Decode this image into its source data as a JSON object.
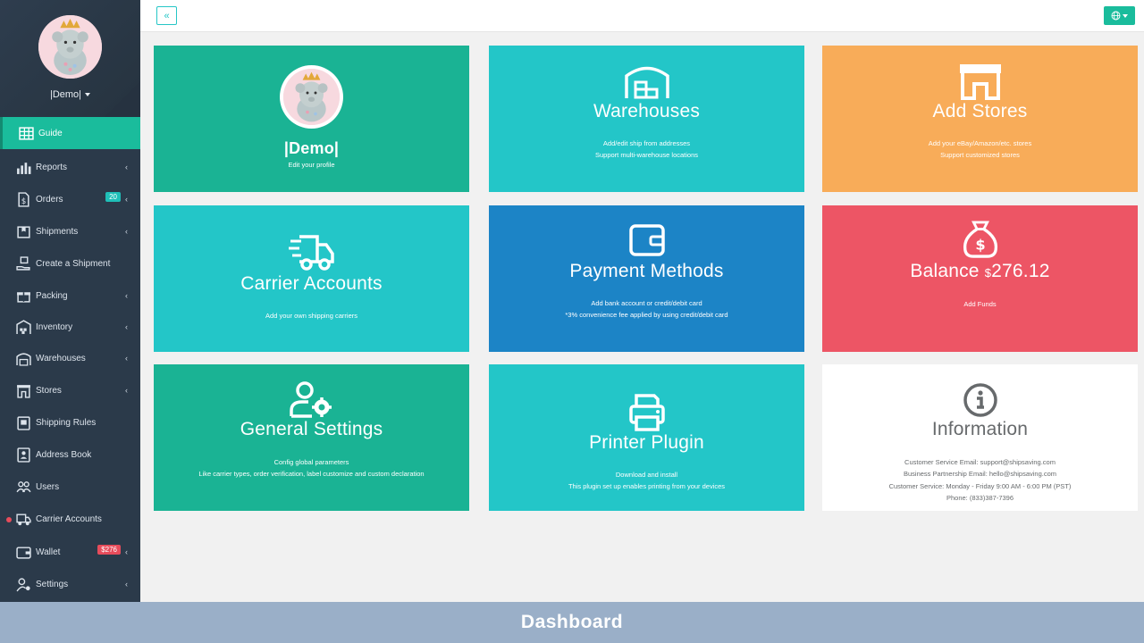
{
  "sidebar": {
    "profile_name": "|Demo|",
    "items": [
      {
        "label": "Guide",
        "icon": "grid-icon"
      },
      {
        "label": "Reports",
        "icon": "bar-chart-icon"
      },
      {
        "label": "Orders",
        "icon": "document-icon",
        "badge": "20"
      },
      {
        "label": "Shipments",
        "icon": "box-icon"
      },
      {
        "label": "Create a Shipment",
        "icon": "hand-box-icon"
      },
      {
        "label": "Packing",
        "icon": "gift-icon"
      },
      {
        "label": "Inventory",
        "icon": "warehouse-icon"
      },
      {
        "label": "Warehouses",
        "icon": "warehouse-icon"
      },
      {
        "label": "Stores",
        "icon": "store-icon"
      },
      {
        "label": "Shipping Rules",
        "icon": "clipboard-icon"
      },
      {
        "label": "Address Book",
        "icon": "address-book-icon"
      },
      {
        "label": "Users",
        "icon": "users-icon"
      },
      {
        "label": "Carrier Accounts",
        "icon": "truck-icon"
      },
      {
        "label": "Wallet",
        "icon": "wallet-icon",
        "badge": "$276"
      },
      {
        "label": "Settings",
        "icon": "user-gear-icon"
      }
    ]
  },
  "topbar": {
    "collapse_label": "«",
    "lang_icon": "globe-icon"
  },
  "cards": {
    "profile": {
      "name": "|Demo|",
      "sub": "Edit your profile"
    },
    "warehouses": {
      "title": "Warehouses",
      "line1": "Add/edit ship from addresses",
      "line2": "Support multi-warehouse locations"
    },
    "stores": {
      "title": "Add Stores",
      "line1": "Add your eBay/Amazon/etc. stores",
      "line2": "Support customized stores"
    },
    "carriers": {
      "title": "Carrier Accounts",
      "line1": "Add your own shipping carriers"
    },
    "payment": {
      "title": "Payment Methods",
      "line1": "Add bank account or credit/debit card",
      "line2": "*3% convenience fee applied by using credit/debit card"
    },
    "balance": {
      "title": "Balance",
      "currency": "$",
      "amount": "276.12",
      "line1": "Add Funds"
    },
    "settings": {
      "title": "General Settings",
      "line1": "Config global parameters",
      "line2": "Like carrier types, order verification, label customize and custom declaration"
    },
    "printer": {
      "title": "Printer Plugin",
      "line1": "Download and install",
      "line2": "This plugin set up enables printing from your devices"
    },
    "information": {
      "title": "Information",
      "line1": "Customer Service Email: support@shipsaving.com",
      "line2": "Business Partnership Email: hello@shipsaving.com",
      "line3": "Customer Service: Monday - Friday 9:00 AM - 6:00 PM (PST)",
      "line4": "Phone: (833)387-7396"
    }
  },
  "footer": {
    "label": "Dashboard"
  },
  "colors": {
    "sidebar": "#2b3a4a",
    "active": "#1abc9c",
    "green": "#1ab394",
    "teal": "#23c6c8",
    "orange": "#f8ac59",
    "blue": "#1c84c6",
    "red": "#ed5565",
    "footer": "#9aafc8"
  }
}
